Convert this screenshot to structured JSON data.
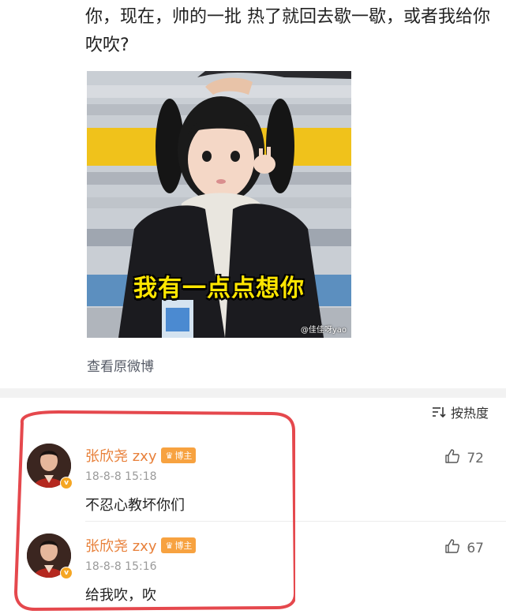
{
  "post": {
    "text": "你，现在，帅的一批 热了就回去歇一歇，或者我给你吹吹?"
  },
  "meme": {
    "caption": "我有一点点想你",
    "watermark": "@佳佳呀yao"
  },
  "view_original_label": "查看原微博",
  "sort_label": "按热度",
  "comments": [
    {
      "username": "张欣尧 zxy",
      "badge": "博主",
      "timestamp": "18-8-8 15:18",
      "text": "不忍心教坏你们",
      "likes": "72"
    },
    {
      "username": "张欣尧 zxy",
      "badge": "博主",
      "timestamp": "18-8-8 15:16",
      "text": "给我吹，吹",
      "likes": "67"
    }
  ],
  "colors": {
    "username": "#e8803a",
    "badge": "#f7a240",
    "highlight": "#e5484d",
    "caption": "#ffe600"
  }
}
